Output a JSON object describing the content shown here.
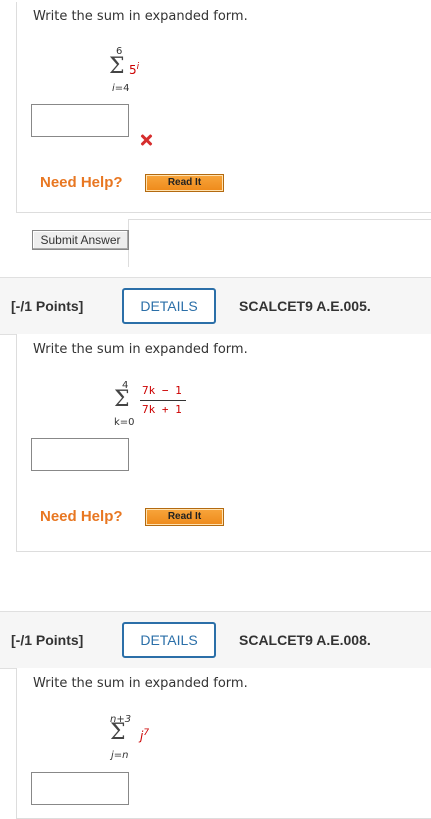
{
  "q1": {
    "prompt": "Write the sum in expanded form.",
    "upper": "6",
    "lower_var": "i",
    "lower_val": "=4",
    "term_base": "5",
    "term_exp": "i",
    "need_help": "Need Help?",
    "read_it": "Read It",
    "submit": "Submit Answer",
    "status": "incorrect"
  },
  "q2": {
    "points": "[-/1 Points]",
    "details": "DETAILS",
    "code": "SCALCET9 A.E.005.",
    "prompt": "Write the sum in expanded form.",
    "upper": "4",
    "lower_var": "k",
    "lower_val": "=0",
    "numerator": "7k − 1",
    "denominator": "7k + 1",
    "need_help": "Need Help?",
    "read_it": "Read It"
  },
  "q3": {
    "points": "[-/1 Points]",
    "details": "DETAILS",
    "code": "SCALCET9 A.E.008.",
    "prompt": "Write the sum in expanded form.",
    "upper": "n+3",
    "lower_var": "j",
    "lower_val": "=n",
    "term_base": "j",
    "term_exp": "7"
  },
  "colors": {
    "accent": "#2b6fa8",
    "help": "#e87722",
    "math": "#cc0000",
    "error": "#d62d2d"
  },
  "icons": {
    "incorrect": "x-mark-icon",
    "sum": "sigma-icon"
  }
}
